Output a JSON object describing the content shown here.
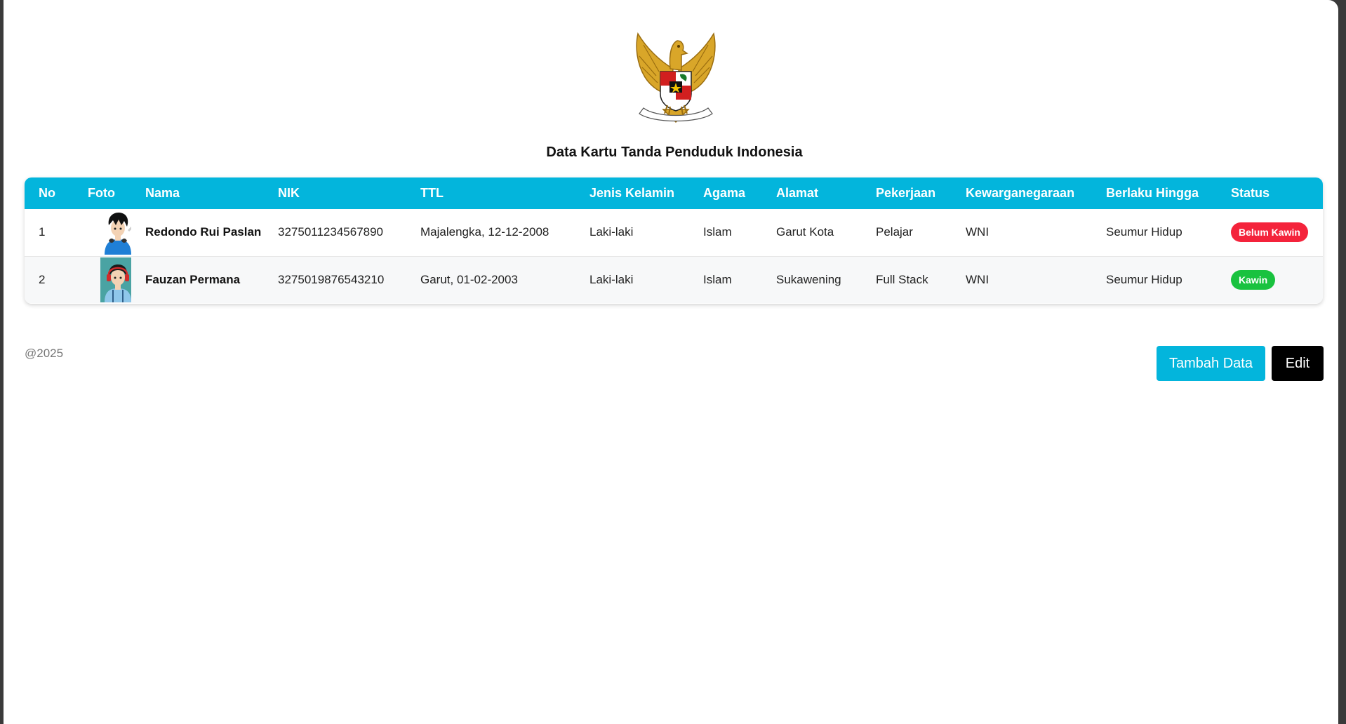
{
  "header": {
    "emblem_icon": "garuda-emblem-icon",
    "title": "Data Kartu Tanda Penduduk Indonesia"
  },
  "colors": {
    "table_header": "#03b5dc",
    "status_single": "#f4233b",
    "status_married": "#19c23f",
    "button_add": "#03b5dc",
    "button_edit": "#000000"
  },
  "table": {
    "columns": [
      "No",
      "Foto",
      "Nama",
      "NIK",
      "TTL",
      "Jenis Kelamin",
      "Agama",
      "Alamat",
      "Pekerjaan",
      "Kewarganegaraan",
      "Berlaku Hingga",
      "Status"
    ],
    "rows": [
      {
        "no": "1",
        "photo_icon": "avatar-boy-headphones-icon",
        "nama": "Redondo Rui Paslan",
        "nik": "3275011234567890",
        "ttl": "Majalengka, 12-12-2008",
        "jenis_kelamin": "Laki-laki",
        "agama": "Islam",
        "alamat": "Garut Kota",
        "pekerjaan": "Pelajar",
        "kewarganegaraan": "WNI",
        "berlaku_hingga": "Seumur Hidup",
        "status": "Belum Kawin"
      },
      {
        "no": "2",
        "photo_icon": "avatar-girl-headphones-icon",
        "nama": "Fauzan Permana",
        "nik": "3275019876543210",
        "ttl": "Garut, 01-02-2003",
        "jenis_kelamin": "Laki-laki",
        "agama": "Islam",
        "alamat": "Sukawening",
        "pekerjaan": "Full Stack",
        "kewarganegaraan": "WNI",
        "berlaku_hingga": "Seumur Hidup",
        "status": "Kawin"
      }
    ]
  },
  "footer": {
    "copyright": "@2025",
    "add_label": "Tambah Data",
    "edit_label": "Edit"
  }
}
